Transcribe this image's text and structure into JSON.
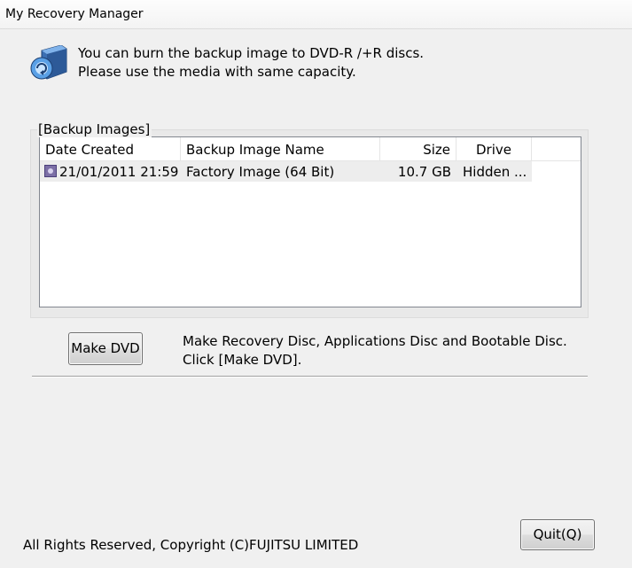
{
  "window": {
    "title": "My Recovery Manager"
  },
  "header": {
    "icon": "recovery-disc-icon",
    "line1": "You can burn the backup image to DVD-R /+R discs.",
    "line2": "Please use the media with same capacity."
  },
  "backup_images": {
    "group_label": "[Backup Images]",
    "columns": [
      "Date Created",
      "Backup Image Name",
      "Size",
      "Drive"
    ],
    "rows": [
      {
        "icon": "backup-image-icon",
        "date_created": "21/01/2011 21:59",
        "name": "Factory Image (64 Bit)",
        "size": "10.7 GB",
        "drive": "Hidden ..."
      }
    ]
  },
  "make_dvd": {
    "button_label": "Make DVD",
    "line1": "Make Recovery Disc, Applications Disc and Bootable Disc.",
    "line2": "Click [Make DVD]."
  },
  "footer": {
    "copyright": "All Rights Reserved, Copyright (C)FUJITSU LIMITED",
    "quit_label": "Quit(Q)"
  }
}
